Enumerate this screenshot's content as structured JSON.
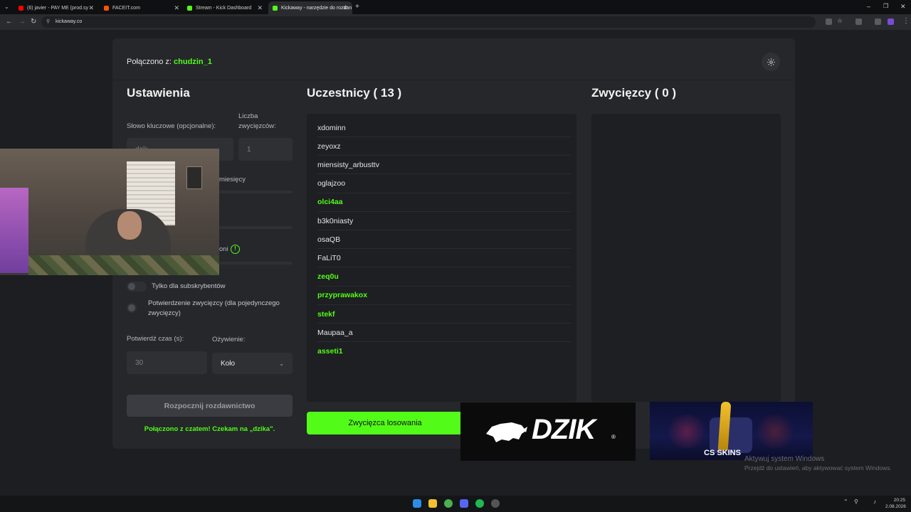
{
  "browser": {
    "tabs": [
      {
        "label": "(6) javier - PAY ME (prod.sy",
        "favicon_color": "#ff0000"
      },
      {
        "label": "FACEIT.com",
        "favicon_color": "#ff5500"
      },
      {
        "label": "Stream - Kick Dashboard",
        "favicon_color": "#53fc18"
      },
      {
        "label": "Kickaway - narzędzie do rozdan",
        "favicon_color": "#53fc18"
      }
    ],
    "url": "kickaway.co"
  },
  "header": {
    "connected_prefix": "Połączono z:",
    "username": "chudzin_1"
  },
  "settings": {
    "title": "Ustawienia",
    "keyword_label": "Słowo kluczowe (opcjonalne):",
    "keyword_placeholder": "dzik",
    "winners_label": "Liczba zwycięzców:",
    "winners_value": "1",
    "partial_label_1": "miesięcy",
    "partial_label_2": "oni",
    "subs_only_label": "Tylko dla subskrybentów",
    "confirm_winner_label": "Potwierdzenie zwycięzcy (dla pojedynczego zwycięzcy)",
    "confirm_time_label": "Potwierdź czas (s):",
    "confirm_time_value": "30",
    "animation_label": "Ożywienie:",
    "animation_value": "Koło",
    "start_button": "Rozpocznij rozdawnictwo",
    "status": "Połączono z czatem! Czekam na „dzika\"."
  },
  "participants": {
    "title": "Uczestnicy ( 13 )",
    "items": [
      {
        "name": "xdominn",
        "highlight": false
      },
      {
        "name": "zeyoxz",
        "highlight": false
      },
      {
        "name": "miensisty_arbusttv",
        "highlight": false
      },
      {
        "name": "oglajzoo",
        "highlight": false
      },
      {
        "name": "olci4aa",
        "highlight": true
      },
      {
        "name": "b3k0niasty",
        "highlight": false
      },
      {
        "name": "osaQB",
        "highlight": false
      },
      {
        "name": "FaLiT0",
        "highlight": false
      },
      {
        "name": "zeq0u",
        "highlight": true
      },
      {
        "name": "przyprawakox",
        "highlight": true
      },
      {
        "name": "stekf",
        "highlight": true
      },
      {
        "name": "Maupaa_a",
        "highlight": false
      },
      {
        "name": "asseti1",
        "highlight": true
      }
    ],
    "draw_button": "Zwycięzca losowania"
  },
  "winners": {
    "title": "Zwycięzcy ( 0 )"
  },
  "overlays": {
    "dzik_logo_text": "DZIK",
    "csskins_text": "CS SKINS"
  },
  "windows_activation": {
    "line1": "Aktywuj system Windows",
    "line2": "Przejdź do ustawień, aby aktywować system Windows."
  },
  "clock": {
    "time": "20:25",
    "date": "2.08.2026"
  },
  "colors": {
    "accent": "#53fc18",
    "card": "#25272b",
    "background": "#1c1e21"
  }
}
